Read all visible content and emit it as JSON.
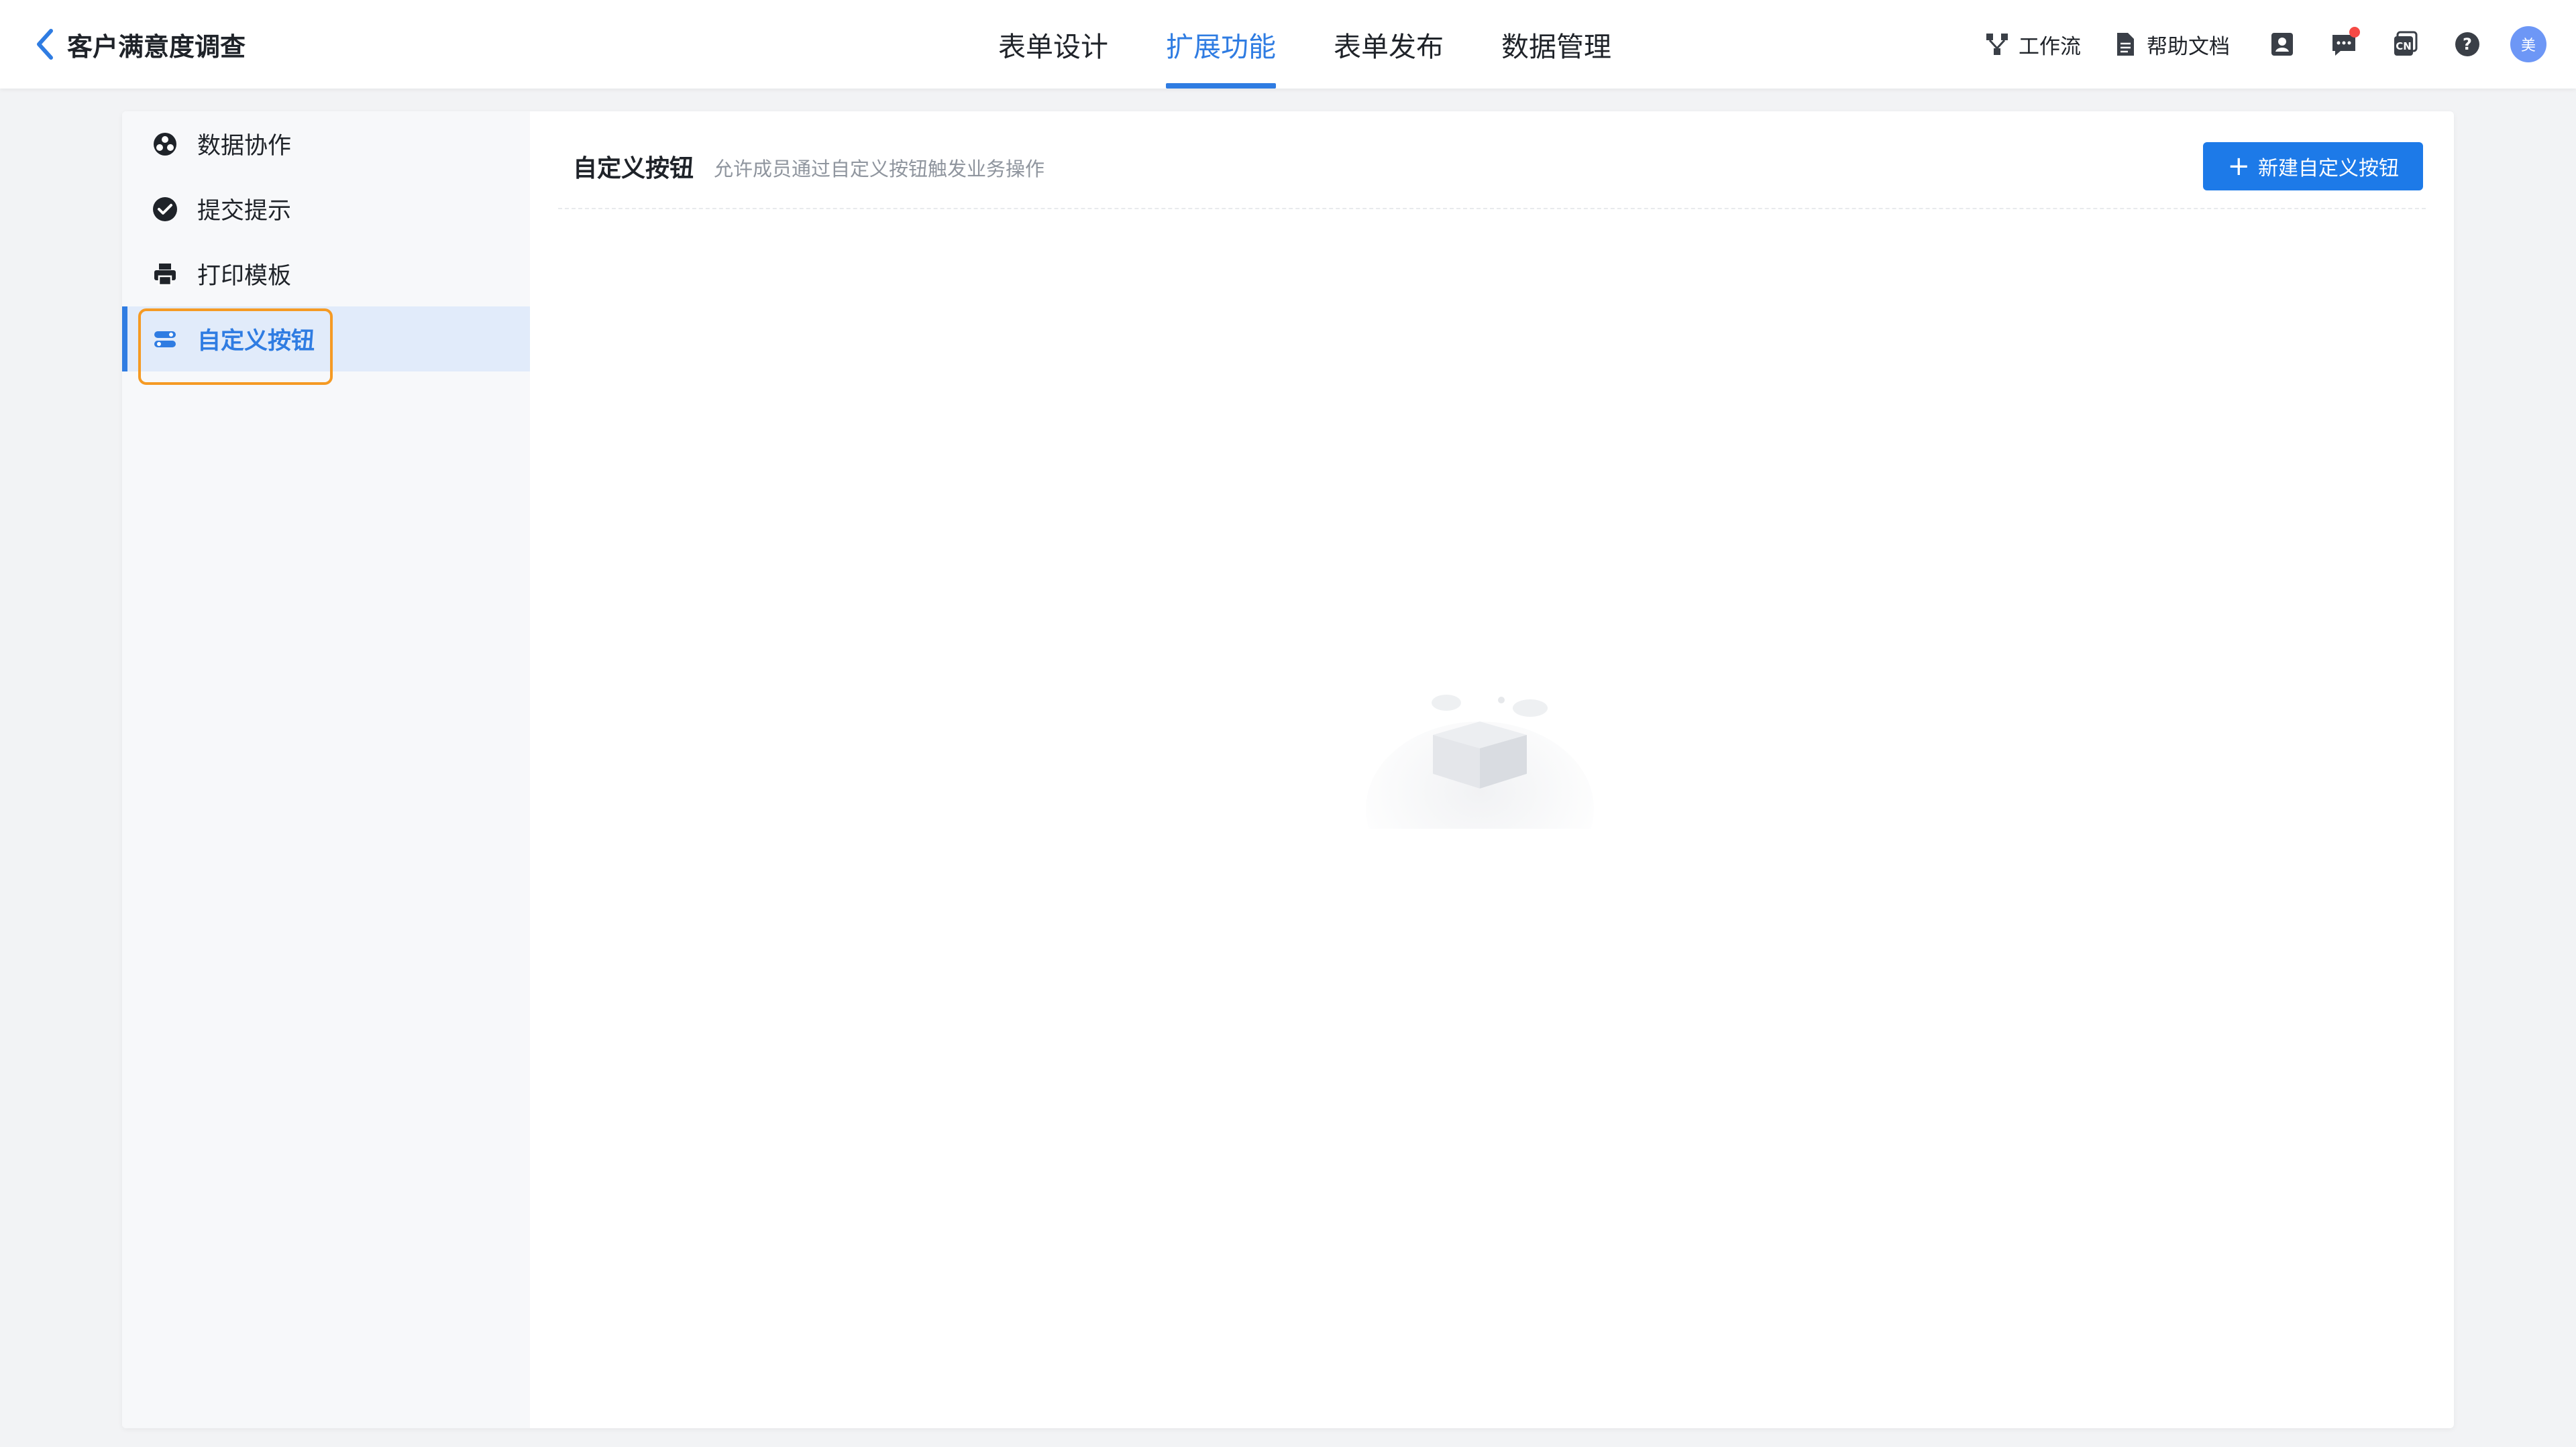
{
  "header": {
    "title": "客户满意度调查",
    "tabs": [
      {
        "label": "表单设计",
        "active": false
      },
      {
        "label": "扩展功能",
        "active": true
      },
      {
        "label": "表单发布",
        "active": false
      },
      {
        "label": "数据管理",
        "active": false
      }
    ],
    "tools": {
      "workflow_label": "工作流",
      "help_label": "帮助文档",
      "avatar_text": "美"
    }
  },
  "sidebar": {
    "items": [
      {
        "label": "数据协作",
        "icon": "data-collab-icon"
      },
      {
        "label": "提交提示",
        "icon": "check-circle-icon"
      },
      {
        "label": "打印模板",
        "icon": "printer-icon"
      },
      {
        "label": "自定义按钮",
        "icon": "custom-button-icon",
        "active": true
      }
    ]
  },
  "content": {
    "title": "自定义按钮",
    "description": "允许成员通过自定义按钮触发业务操作",
    "create_button": "新建自定义按钮"
  },
  "colors": {
    "accent": "#2f7ce2",
    "primary_button": "#1d7ae8",
    "focus_ring": "#f59a23",
    "notification_dot": "#f54a45"
  }
}
